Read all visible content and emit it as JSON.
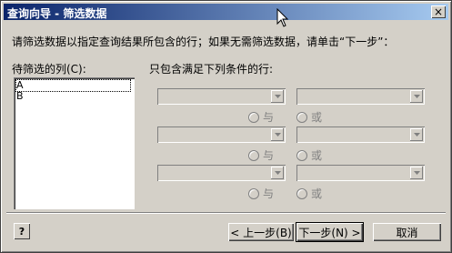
{
  "window": {
    "title": "查询向导 - 筛选数据",
    "close_glyph": "×"
  },
  "instruction": "请筛选数据以指定查询结果所包含的行；如果无需筛选数据，请单击“下一步”：",
  "columns_panel": {
    "label": "待筛选的列(C):",
    "items": [
      "A",
      "B"
    ],
    "selected_index": 0
  },
  "conditions_panel": {
    "label": "只包含满足下列条件的行:",
    "rows": [
      {
        "and_label": "与",
        "or_label": "或"
      },
      {
        "and_label": "与",
        "or_label": "或"
      },
      {
        "and_label": "与",
        "or_label": "或"
      }
    ]
  },
  "buttons": {
    "help": "?",
    "back": "< 上一步(B)",
    "next": "下一步(N) >",
    "cancel": "取消"
  },
  "icons": {
    "dropdown": "chevron-down-icon",
    "help": "help-icon",
    "close": "close-icon"
  }
}
